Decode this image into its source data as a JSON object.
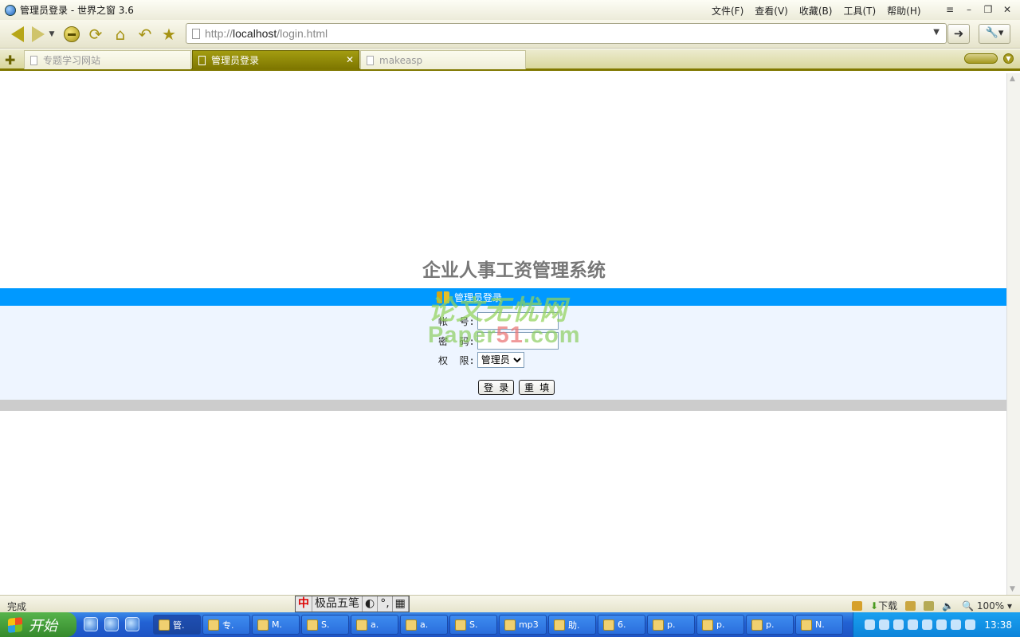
{
  "window": {
    "title": "管理员登录 - 世界之窗 3.6",
    "menus": [
      "文件(F)",
      "查看(V)",
      "收藏(B)",
      "工具(T)",
      "帮助(H)"
    ]
  },
  "toolbar": {
    "url_scheme": "http://",
    "url_host": "localhost",
    "url_path": "/login.html"
  },
  "tabs": [
    {
      "label": "专题学习网站",
      "active": false
    },
    {
      "label": "管理员登录",
      "active": true
    },
    {
      "label": "makeasp",
      "active": false
    }
  ],
  "page": {
    "system_title": "企业人事工资管理系统",
    "panel_title": "管理员登录",
    "account_label": "帐  号:",
    "password_label": "密  码:",
    "role_label": "权  限:",
    "account_value": "",
    "password_value": "",
    "role_selected": "管理员",
    "login_button": "登 录",
    "reset_button": "重 填",
    "colors": {
      "banner": "#0099ff",
      "panel": "#eef5ff",
      "footer_bar": "#cccccc"
    }
  },
  "watermark": {
    "line1": "论文无忧网",
    "line2_a": "Paper",
    "line2_b": "51",
    "line2_c": ".com"
  },
  "statusbar": {
    "text": "完成",
    "ime_name": "极品五笔",
    "ime_mode": "中",
    "download": "下载",
    "zoom": "100%"
  },
  "taskbar": {
    "start": "开始",
    "tasks": [
      "管.",
      "专.",
      "M.",
      "S.",
      "a.",
      "a.",
      "S.",
      "mp3",
      "助.",
      "6.",
      "p.",
      "p.",
      "p.",
      "N."
    ],
    "clock": "13:38"
  }
}
